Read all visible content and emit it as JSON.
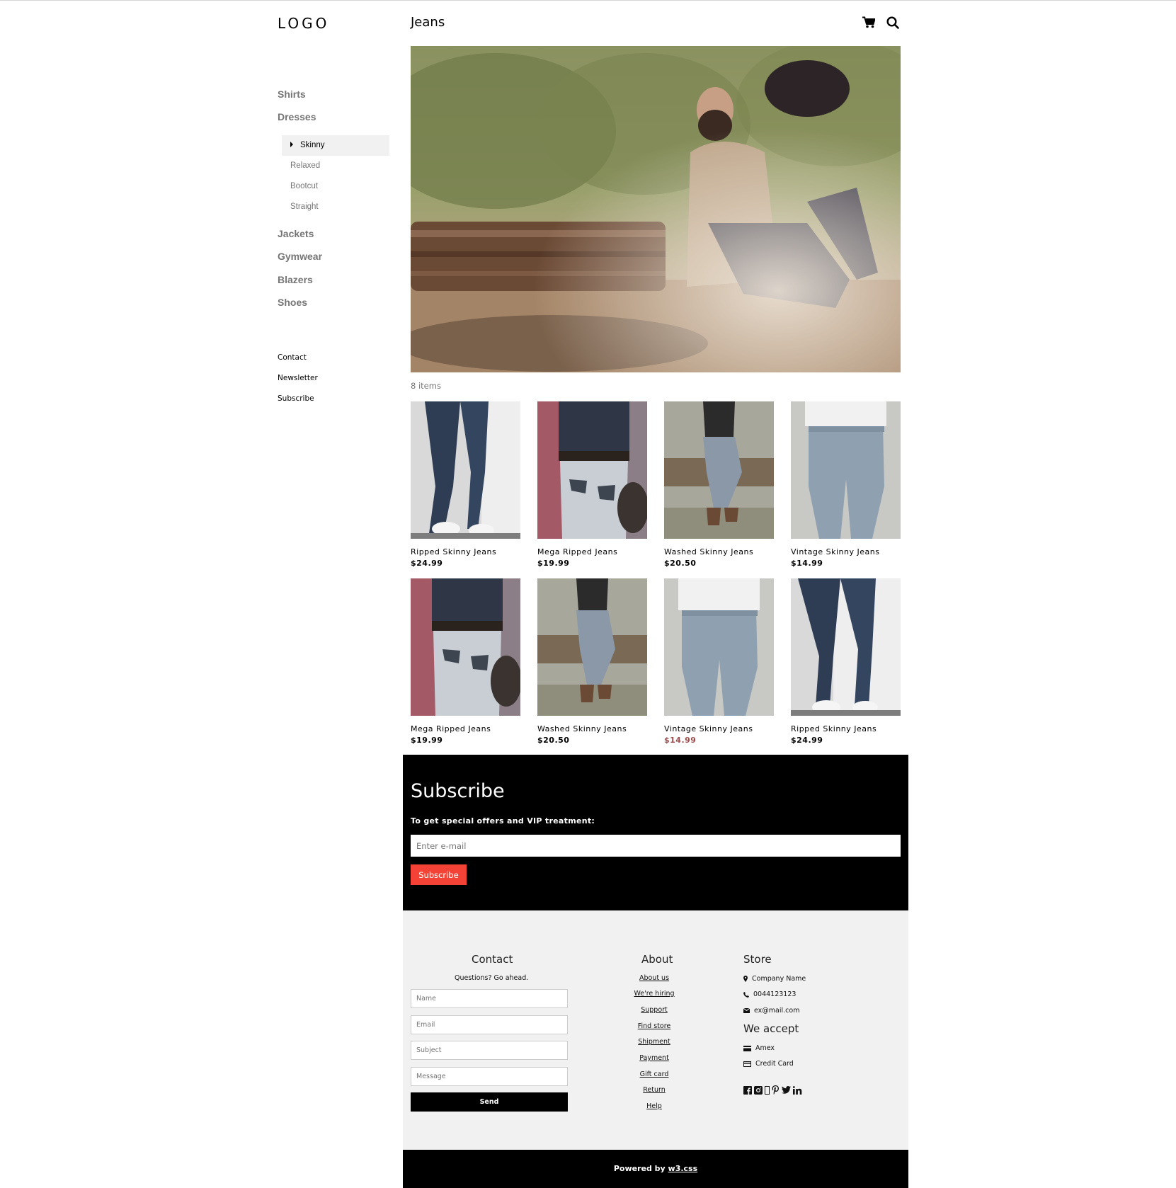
{
  "sidebar": {
    "logo": "LOGO",
    "categories_top": [
      "Shirts",
      "Dresses"
    ],
    "subcategories": [
      {
        "label": "Skinny",
        "active": true
      },
      {
        "label": "Relaxed",
        "active": false
      },
      {
        "label": "Bootcut",
        "active": false
      },
      {
        "label": "Straight",
        "active": false
      }
    ],
    "categories_bottom": [
      "Jackets",
      "Gymwear",
      "Blazers",
      "Shoes"
    ],
    "links": [
      "Contact",
      "Newsletter",
      "Subscribe"
    ]
  },
  "header": {
    "title": "Jeans",
    "icons": [
      "cart-icon",
      "search-icon"
    ]
  },
  "main": {
    "items_count": "8 items",
    "products": [
      {
        "name": "Ripped Skinny Jeans",
        "price": "$24.99",
        "sale": false
      },
      {
        "name": "Mega Ripped Jeans",
        "price": "$19.99",
        "sale": false
      },
      {
        "name": "Washed Skinny Jeans",
        "price": "$20.50",
        "sale": false
      },
      {
        "name": "Vintage Skinny Jeans",
        "price": "$14.99",
        "sale": false
      },
      {
        "name": "Mega Ripped Jeans",
        "price": "$19.99",
        "sale": false
      },
      {
        "name": "Washed Skinny Jeans",
        "price": "$20.50",
        "sale": false
      },
      {
        "name": "Vintage Skinny Jeans",
        "price": "$14.99",
        "sale": true
      },
      {
        "name": "Ripped Skinny Jeans",
        "price": "$24.99",
        "sale": false
      }
    ]
  },
  "subscribe": {
    "title": "Subscribe",
    "text": "To get special offers and VIP treatment:",
    "placeholder": "Enter e-mail",
    "button": "Subscribe"
  },
  "footer": {
    "contact": {
      "title": "Contact",
      "subtitle": "Questions? Go ahead.",
      "name_placeholder": "Name",
      "email_placeholder": "Email",
      "subject_placeholder": "Subject",
      "message_placeholder": "Message",
      "send": "Send"
    },
    "about": {
      "title": "About",
      "links": [
        "About us",
        "We're hiring",
        "Support",
        "Find store",
        "Shipment",
        "Payment",
        "Gift card",
        "Return",
        "Help"
      ]
    },
    "store": {
      "title": "Store",
      "company": "Company Name",
      "phone": "0044123123",
      "email": "ex@mail.com",
      "accept_title": "We accept",
      "amex": "Amex",
      "credit": "Credit Card"
    },
    "social_icons": [
      "facebook-icon",
      "instagram-icon",
      "snapchat-icon",
      "pinterest-icon",
      "twitter-icon",
      "linkedin-icon"
    ]
  },
  "powered": {
    "prefix": "Powered by ",
    "link": "w3.css"
  },
  "colors": {
    "accent_red": "#f44336",
    "sale_price": "#9b4d4d",
    "footer_bg": "#f1f1f1"
  }
}
